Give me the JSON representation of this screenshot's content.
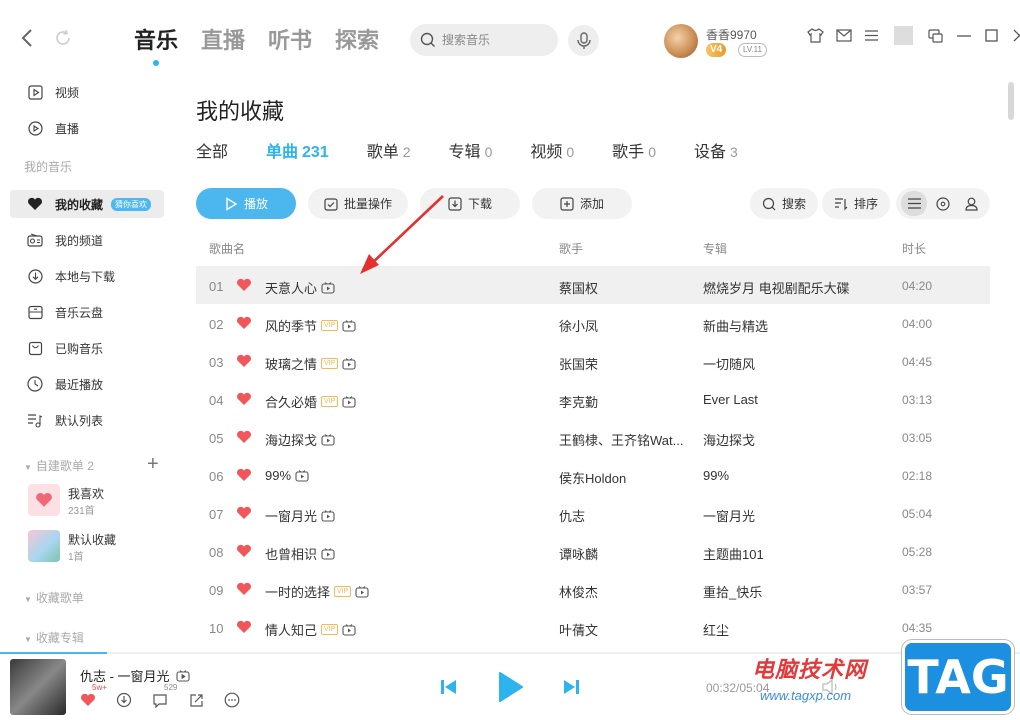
{
  "nav": {
    "main_tabs": [
      "音乐",
      "直播",
      "听书",
      "探索"
    ],
    "active_tab": "音乐",
    "search_placeholder": "搜索音乐"
  },
  "user": {
    "name": "香香9970",
    "vip_level": "4",
    "level": "LV.11"
  },
  "sidebar": {
    "top_items": [
      {
        "label": "视频",
        "icon": "video-icon"
      },
      {
        "label": "直播",
        "icon": "live-icon"
      }
    ],
    "my_music_header": "我的音乐",
    "my_music_items": [
      {
        "label": "我的收藏",
        "icon": "heart-icon",
        "tag": "猜你喜欢",
        "active": true
      },
      {
        "label": "我的频道",
        "icon": "radio-icon"
      },
      {
        "label": "本地与下载",
        "icon": "download-icon"
      },
      {
        "label": "音乐云盘",
        "icon": "cloud-disk-icon"
      },
      {
        "label": "已购音乐",
        "icon": "purchased-icon"
      },
      {
        "label": "最近播放",
        "icon": "clock-icon"
      },
      {
        "label": "默认列表",
        "icon": "list-icon"
      }
    ],
    "created_header": "自建歌单 2",
    "playlists": [
      {
        "name": "我喜欢",
        "count": "231首",
        "cover_color": "#fde0e3"
      },
      {
        "name": "默认收藏",
        "count": "1首",
        "cover_color": "#a9d6f0"
      }
    ],
    "collected_playlists_header": "收藏歌单",
    "collected_albums_header": "收藏专辑"
  },
  "page": {
    "title": "我的收藏",
    "sub_tabs": [
      {
        "label": "全部",
        "count": ""
      },
      {
        "label": "单曲",
        "count": "231",
        "active": true
      },
      {
        "label": "歌单",
        "count": "2"
      },
      {
        "label": "专辑",
        "count": "0"
      },
      {
        "label": "视频",
        "count": "0"
      },
      {
        "label": "歌手",
        "count": "0"
      },
      {
        "label": "设备",
        "count": "3"
      }
    ],
    "toolbar": {
      "play": "播放",
      "batch": "批量操作",
      "download": "下载",
      "add": "添加",
      "search": "搜索",
      "sort": "排序"
    }
  },
  "table": {
    "headers": {
      "song": "歌曲名",
      "artist": "歌手",
      "album": "专辑",
      "duration": "时长"
    },
    "rows": [
      {
        "num": "01",
        "title": "天意人心",
        "vip": false,
        "artist": "蔡国权",
        "album": "燃烧岁月 电视剧配乐大碟",
        "duration": "04:20"
      },
      {
        "num": "02",
        "title": "风的季节",
        "vip": true,
        "artist": "徐小凤",
        "album": "新曲与精选",
        "duration": "04:00"
      },
      {
        "num": "03",
        "title": "玻璃之情",
        "vip": true,
        "artist": "张国荣",
        "album": "一切随风",
        "duration": "04:45"
      },
      {
        "num": "04",
        "title": "合久必婚",
        "vip": true,
        "artist": "李克勤",
        "album": "Ever Last",
        "duration": "03:13"
      },
      {
        "num": "05",
        "title": "海边探戈",
        "vip": false,
        "artist": "王鹤棣、王齐铭Wat...",
        "album": "海边探戈",
        "duration": "03:05"
      },
      {
        "num": "06",
        "title": "99%",
        "vip": false,
        "artist": "侯东Holdon",
        "album": "99%",
        "duration": "02:18"
      },
      {
        "num": "07",
        "title": "一窗月光",
        "vip": false,
        "artist": "仇志",
        "album": "一窗月光",
        "duration": "05:04"
      },
      {
        "num": "08",
        "title": "也曾相识",
        "vip": false,
        "artist": "谭咏麟",
        "album": "主题曲101",
        "duration": "05:28"
      },
      {
        "num": "09",
        "title": "一时的选择",
        "vip": true,
        "artist": "林俊杰",
        "album": "重拾_快乐",
        "duration": "03:57"
      },
      {
        "num": "10",
        "title": "情人知己",
        "vip": true,
        "artist": "叶蒨文",
        "album": "红尘",
        "duration": "04:35"
      }
    ]
  },
  "player": {
    "now_playing": "仇志 - 一窗月光",
    "like_count": "5w+",
    "comment_count": "529",
    "time": "00:32/05:04",
    "progress": 0.105
  },
  "watermark": {
    "site_name": "电脑技术网",
    "url": "www.tagxp.com",
    "logo_text": "TAG"
  },
  "colors": {
    "accent": "#2db4ee",
    "heart": "#f0565a",
    "vip": "#f2b85a"
  }
}
